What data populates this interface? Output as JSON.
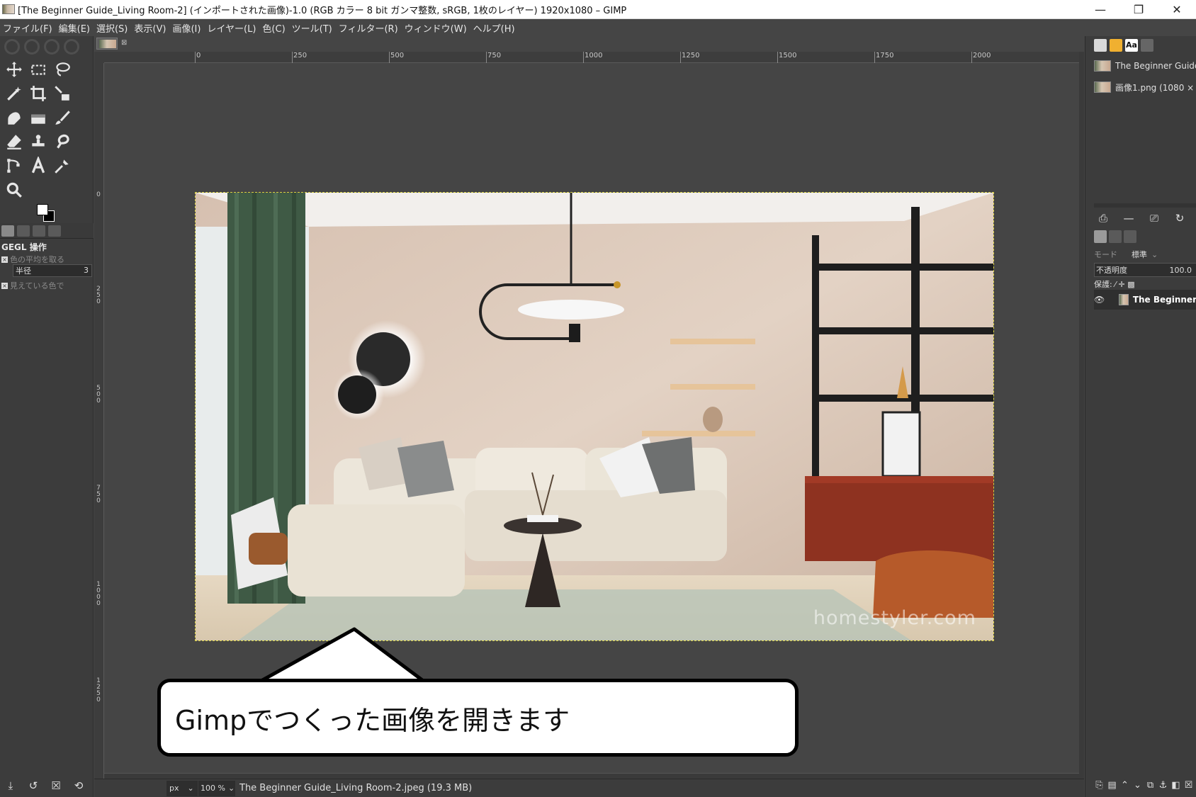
{
  "window": {
    "title": "[The Beginner Guide_Living Room-2] (インポートされた画像)-1.0 (RGB カラー 8 bit ガンマ整数, sRGB, 1枚のレイヤー) 1920x1080 – GIMP",
    "minimize": "—",
    "restore": "❐",
    "close": "✕"
  },
  "menu": [
    "ファイル(F)",
    "編集(E)",
    "選択(S)",
    "表示(V)",
    "画像(I)",
    "レイヤー(L)",
    "色(C)",
    "ツール(T)",
    "フィルター(R)",
    "ウィンドウ(W)",
    "ヘルプ(H)"
  ],
  "tool_options": {
    "title": "GEGL 操作",
    "sample_average": "色の平均を取る",
    "radius_label": "半径",
    "radius_value": "3",
    "sample_merged": "見えている色で"
  },
  "ruler": {
    "h_labels": [
      "0",
      "250",
      "500",
      "750",
      "1000",
      "1250",
      "1500",
      "1750",
      "2000"
    ],
    "v_labels": [
      "0",
      "250",
      "500",
      "750",
      "1000",
      "1250"
    ]
  },
  "image": {
    "watermark": "homestyler.com"
  },
  "callout": {
    "text": "Gimpでつくった画像を開きます"
  },
  "status": {
    "unit": "px",
    "zoom": "100 %",
    "file_info": "The Beginner Guide_Living Room-2.jpeg (19.3 MB)"
  },
  "dock": {
    "font_tab": "Aa",
    "images": [
      "The Beginner Guide",
      "画像1.png (1080 ×"
    ],
    "mode_label": "モード",
    "mode_value": "標準",
    "opacity_label": "不透明度",
    "opacity_value": "100.0",
    "lock_label": "保護: ⁄ ✛ ▩",
    "layer_name": "The Beginner"
  },
  "colors": {
    "ui_background": "#454545",
    "panel": "#3c3c3c",
    "selection_outline": "#d8d040"
  }
}
